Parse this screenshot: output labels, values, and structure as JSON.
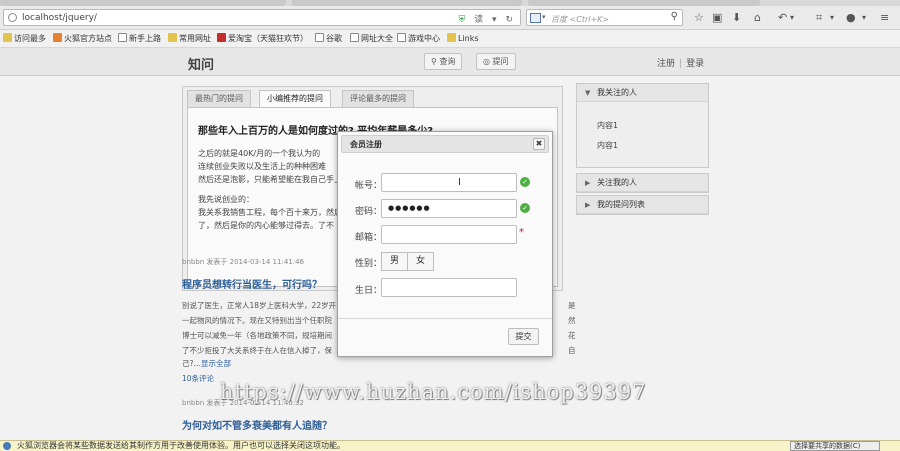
{
  "browser": {
    "url": "localhost/jquery/",
    "url_reader_label": "读",
    "search_placeholder": "百度 <Ctrl+K>",
    "bookmarks": [
      {
        "label": "访问最多",
        "icon": "folder-icon"
      },
      {
        "label": "火狐官方站点",
        "icon": "firefox-icon"
      },
      {
        "label": "新手上路",
        "icon": "page-icon"
      },
      {
        "label": "常用网址",
        "icon": "folder-icon"
      },
      {
        "label": "爱淘宝（天猫狂欢节）",
        "icon": "taobao-icon"
      },
      {
        "label": "谷歌",
        "icon": "page-icon"
      },
      {
        "label": "网址大全",
        "icon": "page-icon"
      },
      {
        "label": "游戏中心",
        "icon": "page-icon"
      },
      {
        "label": "Links",
        "icon": "folder-icon"
      }
    ]
  },
  "header": {
    "logo": "知问",
    "search_button": "查询",
    "ask_button": "提问",
    "register_link": "注册",
    "login_link": "登录",
    "separator": "|"
  },
  "content_tabs": [
    {
      "label": "最热门的提问"
    },
    {
      "label": "小编推荐的提问"
    },
    {
      "label": "评论最多的提问"
    }
  ],
  "featured": {
    "title": "那些年入上百万的人是如何度过的? 平均年薪是多少?",
    "body_lines": [
      "之后的就是40K/月的一个我认为的",
      "连续创业失败以及生活上的种种困难",
      "然后还是泡影，只能希望能在我自己手上",
      "我先说创业的：",
      "我关系我销售工程，每个百十来万，然后",
      "了，然后是你的内心能够过得去。了不"
    ]
  },
  "question2": {
    "meta": "bnbbn 发表于 2014-03-14 11:41:46",
    "title": "程序员想转行当医生，可行吗？",
    "body_lines": [
      "别说了医生，正常人18岁上医科大学，22岁开",
      "一起物风的情况下。现在又特别出当个任职院",
      "博士可以减免一年（各地政策不同，规培期间",
      "了不少拒投了大关系终于在人在信入掉了，保"
    ],
    "body_tail": "己?…",
    "show_all": "显示全部",
    "comments": "10条评论",
    "edge_fragments": [
      "是",
      "然",
      "花",
      "自"
    ]
  },
  "question3": {
    "meta": "bnbbn 发表于 2014-03-14 11:40:32",
    "title": "为何对如不管多衰美都有人追随？"
  },
  "sidebar": {
    "panels": [
      {
        "title": "我关注的人",
        "expanded": true,
        "items": [
          "内容1",
          "内容1"
        ]
      },
      {
        "title": "关注我的人",
        "expanded": false,
        "items": []
      },
      {
        "title": "我的提问列表",
        "expanded": false,
        "items": []
      }
    ]
  },
  "modal": {
    "title": "会员注册",
    "close": "✖",
    "fields": {
      "username_label": "帐号：",
      "username_value": "",
      "password_label": "密码：",
      "password_value": "●●●●●●",
      "email_label": "邮箱：",
      "email_value": "",
      "email_required": "*",
      "gender_label": "性别：",
      "gender_male": "男",
      "gender_female": "女",
      "birthday_label": "生日：",
      "birthday_value": ""
    },
    "submit": "提交",
    "valid_mark": "✓"
  },
  "watermark": "https://www.huzhan.com/ishop39397",
  "notification": {
    "text": "火狐浏览器会将某些数据发送给其制作方用于改善使用体验。用户也可以选择关闭这项功能。",
    "button": "选择要共享的数据(C)"
  },
  "colors": {
    "link": "#2f5f98",
    "valid": "#4caf3f",
    "required": "#c62020"
  }
}
